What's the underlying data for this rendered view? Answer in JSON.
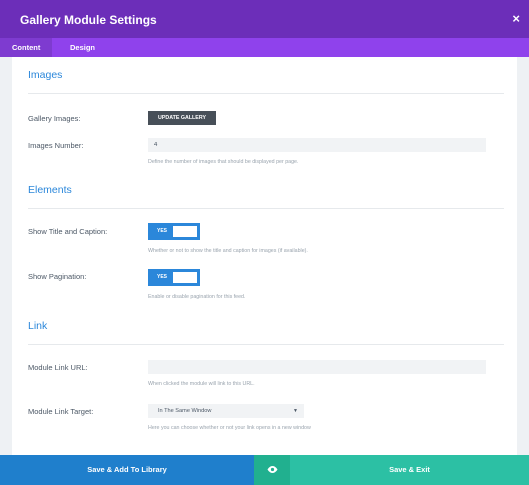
{
  "header": {
    "title": "Gallery Module Settings",
    "close_symbol": "×"
  },
  "tabs": [
    {
      "label": "Content",
      "active": true
    },
    {
      "label": "Design",
      "active": false
    }
  ],
  "sections": {
    "images": {
      "title": "Images",
      "gallery_images_label": "Gallery Images:",
      "update_gallery_button": "UPDATE GALLERY",
      "images_number_label": "Images Number:",
      "images_number_value": "4",
      "images_number_desc": "Define the number of images that should be displayed per page."
    },
    "elements": {
      "title": "Elements",
      "show_title_label": "Show Title and Caption:",
      "show_title_toggle": "YES",
      "show_title_desc": "Whether or not to show the title and caption for images (if available).",
      "show_pagination_label": "Show Pagination:",
      "show_pagination_toggle": "YES",
      "show_pagination_desc": "Enable or disable pagination for this feed."
    },
    "link": {
      "title": "Link",
      "url_label": "Module Link URL:",
      "url_value": "",
      "url_desc": "When clicked the module will link to this URL.",
      "target_label": "Module Link Target:",
      "target_value": "In The Same Window",
      "target_arrow": "▼",
      "target_desc": "Here you can choose whether or not your link opens in a new window"
    }
  },
  "footer": {
    "save_library_label": "Save & Add To Library",
    "save_exit_label": "Save & Exit",
    "preview_icon": "eye-icon"
  },
  "colors": {
    "header": "#6c2eb9",
    "tabs": "#8f42ec",
    "section_title": "#2b87da",
    "toggle": "#2b87da",
    "save_library": "#1f7fcc",
    "save_exit": "#2cc0a4"
  }
}
